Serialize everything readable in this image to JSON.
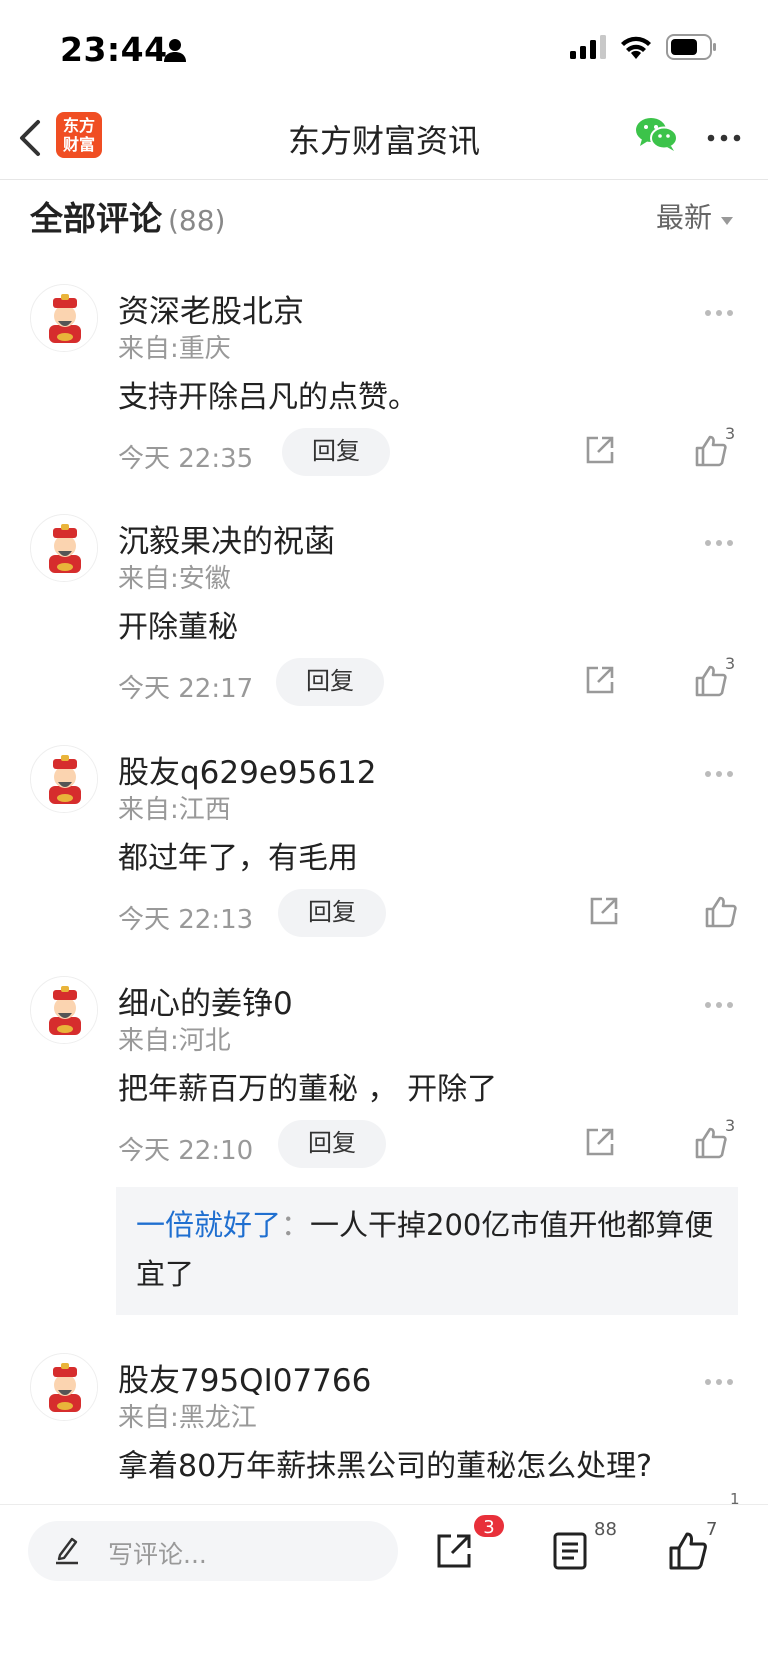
{
  "status": {
    "time": "23:44"
  },
  "nav": {
    "logo_line1": "东方",
    "logo_line2": "财富",
    "title": "东方财富资讯"
  },
  "section": {
    "title": "全部评论",
    "count": "(88)",
    "sort_label": "最新"
  },
  "comments": [
    {
      "name": "资深老股北京",
      "from": "来自:重庆",
      "text": "支持开除吕凡的点赞。",
      "time": "今天 22:35",
      "reply": "回复",
      "likes": "3"
    },
    {
      "name": "沉毅果决的祝菡",
      "from": "来自:安徽",
      "text": "开除董秘",
      "time": "今天 22:17",
      "reply": "回复",
      "likes": "3"
    },
    {
      "name": "股友q629e95612",
      "from": "来自:江西",
      "text": "都过年了，有毛用",
      "time": "今天 22:13",
      "reply": "回复",
      "likes": ""
    },
    {
      "name": "细心的姜铮0",
      "from": "来自:河北",
      "text": "把年薪百万的董秘 ， 开除了",
      "time": "今天 22:10",
      "reply": "回复",
      "likes": "3"
    },
    {
      "name": "股友795QI07766",
      "from": "来自:黑龙江",
      "text": "拿着80万年薪抹黑公司的董秘怎么处理?",
      "time": "",
      "reply": "",
      "likes": "1"
    }
  ],
  "sub_reply": {
    "name": "一倍就好了",
    "colon": "：",
    "text": "一人干掉200亿市值开他都算便宜了"
  },
  "bottom": {
    "placeholder": "写评论...",
    "share_badge": "3",
    "comment_count": "88",
    "like_count": "7"
  }
}
